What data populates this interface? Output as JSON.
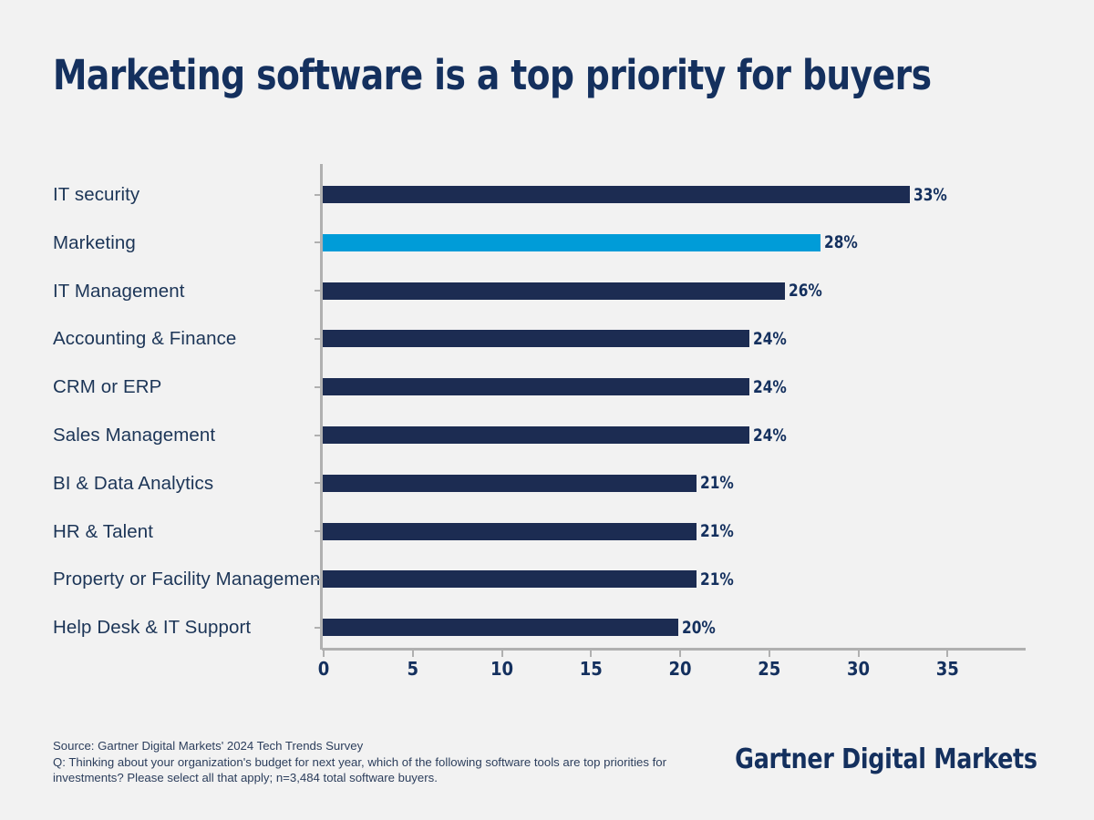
{
  "title": "Marketing software is a top priority for buyers",
  "colors": {
    "background": "#f2f2f2",
    "bar": "#1c2c52",
    "bar_highlight": "#009cd8",
    "text_dark": "#14305e",
    "label": "#1c3557",
    "axis": "#b0b0b0"
  },
  "chart_data": {
    "type": "bar",
    "orientation": "horizontal",
    "title": "Marketing software is a top priority for buyers",
    "xlabel": "",
    "ylabel": "",
    "xlim": [
      0,
      39.5
    ],
    "xticks": [
      0,
      5,
      10,
      15,
      20,
      25,
      30,
      35
    ],
    "xtick_labels": [
      "0",
      "5",
      "10",
      "15",
      "20",
      "25",
      "30",
      "35"
    ],
    "grid": false,
    "legend": null,
    "highlight_category": "Marketing",
    "categories": [
      "IT security",
      "Marketing",
      "IT Management",
      "Accounting & Finance",
      "CRM or ERP",
      "Sales Management",
      "BI & Data Analytics",
      "HR & Talent",
      "Property or Facility Management",
      "Help Desk & IT Support"
    ],
    "values": [
      33,
      28,
      26,
      24,
      24,
      24,
      21,
      21,
      21,
      20
    ],
    "value_labels": [
      "33%",
      "28%",
      "26%",
      "24%",
      "24%",
      "24%",
      "21%",
      "21%",
      "21%",
      "20%"
    ],
    "bar_colors": [
      "#1c2c52",
      "#009cd8",
      "#1c2c52",
      "#1c2c52",
      "#1c2c52",
      "#1c2c52",
      "#1c2c52",
      "#1c2c52",
      "#1c2c52",
      "#1c2c52"
    ]
  },
  "footer": {
    "source_line": "Source: Gartner Digital Markets' 2024 Tech Trends Survey",
    "question_line": "Q: Thinking about your organization's budget for next year, which of the following software tools are top priorities for investments? Please select all that apply; n=3,484 total software buyers.",
    "logo": "Gartner Digital Markets"
  }
}
